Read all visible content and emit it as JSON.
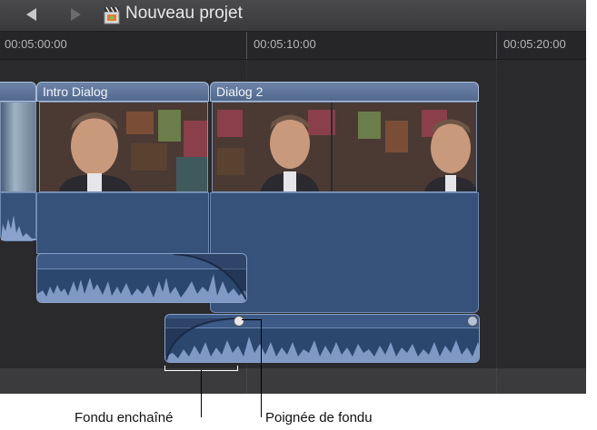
{
  "window": {
    "project_title": "Nouveau projet",
    "icons": [
      "back-arrow-icon",
      "forward-arrow-icon",
      "project-clapper-icon"
    ]
  },
  "ruler": {
    "timecodes": [
      "00:05:00:00",
      "00:05:10:00",
      "00:05:20:00"
    ]
  },
  "clips": {
    "intro": {
      "title": "Intro Dialog"
    },
    "dialog2": {
      "title": "Dialog 2"
    }
  },
  "colors": {
    "clip_blue": "#5e76a0",
    "audio_blue": "#2b476e",
    "waveform": "#7f98c4",
    "background": "#2c2c2e"
  },
  "annotations": {
    "crossfade_label": "Fondu enchaîné",
    "handle_label": "Poignée de fondu"
  }
}
